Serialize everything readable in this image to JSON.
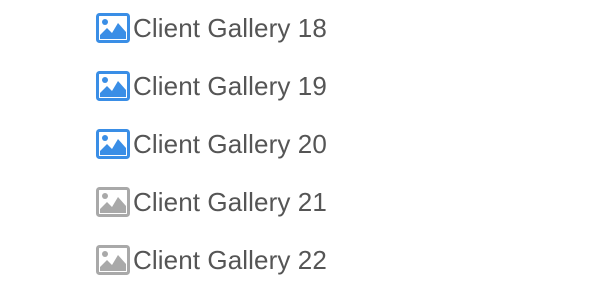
{
  "colors": {
    "active_icon": "#3a8ee6",
    "inactive_icon": "#a9a9a9",
    "label_text": "#555555"
  },
  "galleries": [
    {
      "label": "Client Gallery 18",
      "icon": "image-icon",
      "state": "active"
    },
    {
      "label": "Client Gallery 19",
      "icon": "image-icon",
      "state": "active"
    },
    {
      "label": "Client Gallery 20",
      "icon": "image-icon",
      "state": "active"
    },
    {
      "label": "Client Gallery 21",
      "icon": "image-icon",
      "state": "inactive"
    },
    {
      "label": "Client Gallery 22",
      "icon": "image-icon",
      "state": "inactive"
    }
  ]
}
